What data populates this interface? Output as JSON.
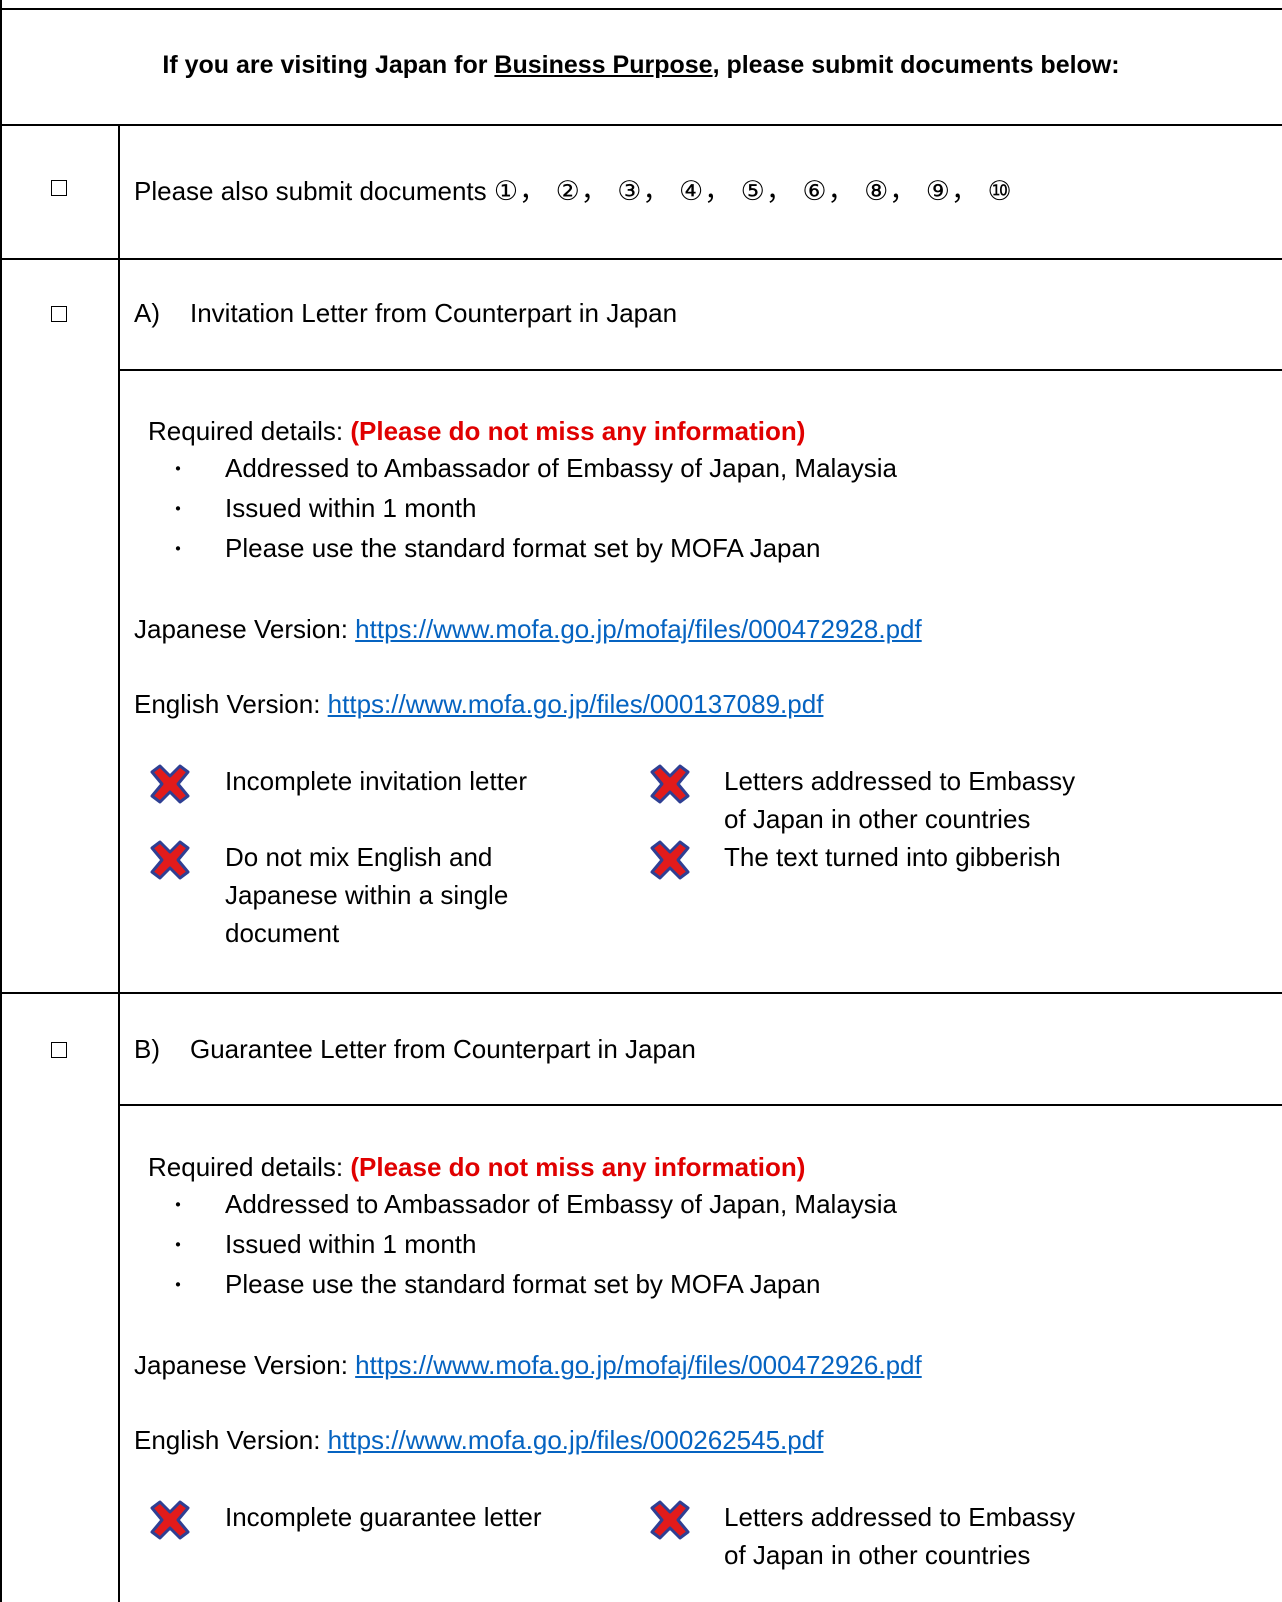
{
  "header": {
    "prefix": "If you are visiting Japan for ",
    "emph": "Business Purpose",
    "suffix": ", please submit documents below:"
  },
  "row_docs": {
    "text": "Please also submit documents ",
    "numbers": "①， ②， ③， ④， ⑤， ⑥， ⑧， ⑨， ⑩"
  },
  "section_a": {
    "label": "A)",
    "title": "Invitation Letter from Counterpart in Japan",
    "required_label": "Required details: ",
    "required_note": "(Please do not miss any information)",
    "bullet_symbol": "・",
    "bullets": [
      "Addressed to Ambassador of Embassy of Japan, Malaysia",
      "Issued within 1 month",
      "Please use the standard format set by MOFA Japan"
    ],
    "jp_label": "Japanese Version: ",
    "jp_url": "https://www.mofa.go.jp/mofaj/files/000472928.pdf",
    "en_label": "English Version: ",
    "en_url": "https://www.mofa.go.jp/files/000137089.pdf",
    "donts": [
      "Incomplete invitation letter",
      [
        "Letters addressed to Embassy",
        "of Japan in other countries"
      ],
      [
        "Do not mix English and",
        "Japanese within a single",
        "document"
      ],
      "The text turned into gibberish"
    ]
  },
  "section_b": {
    "label": "B)",
    "title": "Guarantee Letter from Counterpart in Japan",
    "required_label": "Required details: ",
    "required_note": "(Please do not miss any information)",
    "bullet_symbol": "・",
    "bullets": [
      "Addressed to Ambassador of Embassy of Japan, Malaysia",
      "Issued within 1 month",
      "Please use the standard format set by MOFA Japan"
    ],
    "jp_label": "Japanese Version: ",
    "jp_url": "https://www.mofa.go.jp/mofaj/files/000472926.pdf",
    "en_label": "English Version: ",
    "en_url": "https://www.mofa.go.jp/files/000262545.pdf",
    "donts": [
      "Incomplete guarantee letter",
      [
        "Letters addressed to Embassy",
        "of Japan in other countries"
      ]
    ]
  },
  "colors": {
    "red": "#e00000",
    "link": "#0563c1",
    "x_fill": "#e21b1b",
    "x_stroke": "#2f3f93"
  },
  "icons": {
    "checkbox": "empty-checkbox-icon",
    "dont": "red-x-icon"
  }
}
